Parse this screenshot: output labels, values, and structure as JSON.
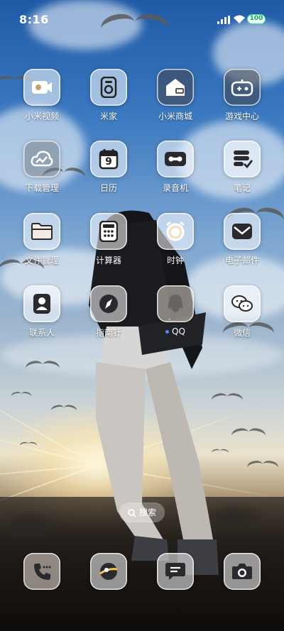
{
  "status_bar": {
    "time": "8:16",
    "battery": "100"
  },
  "apps": [
    {
      "label": "小米视频",
      "icon": "video-icon"
    },
    {
      "label": "米家",
      "icon": "speaker-icon"
    },
    {
      "label": "小米商城",
      "icon": "store-icon"
    },
    {
      "label": "游戏中心",
      "icon": "gamepad-icon"
    },
    {
      "label": "下载管理",
      "icon": "download-cloud-icon"
    },
    {
      "label": "日历",
      "icon": "calendar-icon",
      "date": "9"
    },
    {
      "label": "录音机",
      "icon": "recorder-icon"
    },
    {
      "label": "笔记",
      "icon": "notes-icon"
    },
    {
      "label": "文件管理",
      "icon": "folder-icon"
    },
    {
      "label": "计算器",
      "icon": "calculator-icon"
    },
    {
      "label": "时钟",
      "icon": "alarm-clock-icon"
    },
    {
      "label": "电子邮件",
      "icon": "mail-icon"
    },
    {
      "label": "联系人",
      "icon": "contact-icon"
    },
    {
      "label": "指南针",
      "icon": "compass-icon"
    },
    {
      "label": "QQ",
      "icon": "qq-icon"
    },
    {
      "label": "微信",
      "icon": "wechat-icon"
    }
  ],
  "search": {
    "label": "搜索",
    "icon": "search-icon"
  },
  "dock": [
    {
      "icon": "phone-icon"
    },
    {
      "icon": "browser-icon"
    },
    {
      "icon": "message-icon"
    },
    {
      "icon": "camera-icon"
    }
  ]
}
